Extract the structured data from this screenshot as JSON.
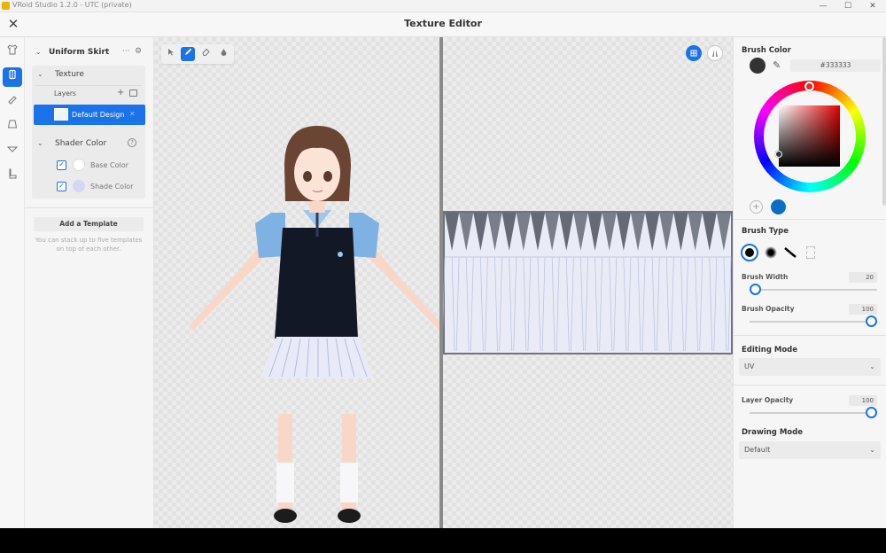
{
  "os": {
    "title": "VRoid Studio 1.2.0 - UTC (private)",
    "minimize": "—",
    "maximize": "☐",
    "close": "✕"
  },
  "app": {
    "title": "Texture Editor",
    "close_glyph": "✕"
  },
  "rail": {
    "icons": [
      "shirt-icon",
      "jacket-icon",
      "tie-icon",
      "skirt-icon",
      "accessory-icon",
      "shoe-icon"
    ]
  },
  "left_panel": {
    "item_name": "Uniform Skirt",
    "texture_section": "Texture",
    "layers_label": "Layers",
    "layer_name": "Default Design",
    "shader_section": "Shader Color",
    "base_color_label": "Base Color",
    "shade_color_label": "Shade Color",
    "base_color": "#ffffff",
    "shade_color": "#d4d8f2",
    "add_template": "Add a Template",
    "template_hint": "You can stack up to five templates on top of each other."
  },
  "right_panel": {
    "brush_color_label": "Brush Color",
    "brush_hex": "#333333",
    "current_color": "#333333",
    "saved_color": "#0a6fc2",
    "brush_type_label": "Brush Type",
    "brush_width_label": "Brush Width",
    "brush_width_value": "20",
    "brush_width": 20,
    "brush_opacity_label": "Brush Opacity",
    "brush_opacity_value": "100",
    "brush_opacity": 100,
    "editing_mode_label": "Editing Mode",
    "editing_mode_value": "UV",
    "layer_opacity_label": "Layer Opacity",
    "layer_opacity_value": "100",
    "layer_opacity": 100,
    "drawing_mode_label": "Drawing Mode",
    "drawing_mode_value": "Default"
  },
  "colors": {
    "accent": "#1a73e8"
  }
}
